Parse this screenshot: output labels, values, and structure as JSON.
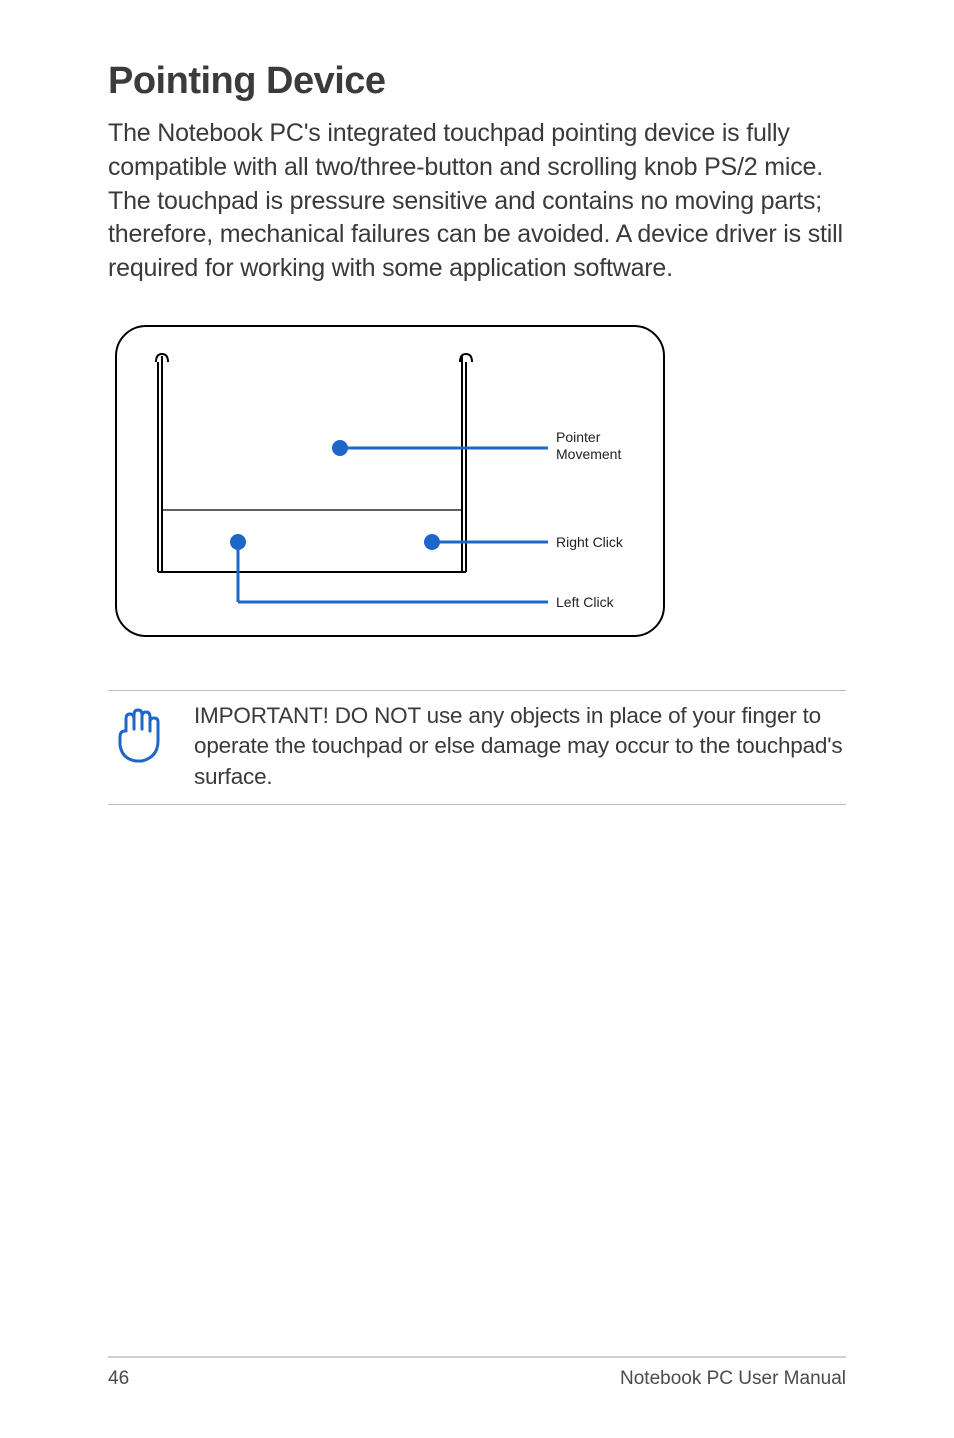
{
  "heading": "Pointing Device",
  "body": "The Notebook PC's integrated touchpad pointing device is fully compatible with all two/three-button and scrolling knob PS/2 mice. The touchpad is pressure sensitive and contains no moving parts; therefore, mechanical failures can be avoided. A device driver is still required for working with some application software.",
  "diagram": {
    "label_pointer_line1": "Pointer",
    "label_pointer_line2": "Movement",
    "label_right": "Right Click",
    "label_left": "Left Click"
  },
  "note": "IMPORTANT! DO NOT use any objects in place of your finger to operate the touchpad or else damage may occur to the touchpad's surface.",
  "footer": {
    "page_number": "46",
    "manual_title": "Notebook PC User Manual"
  }
}
